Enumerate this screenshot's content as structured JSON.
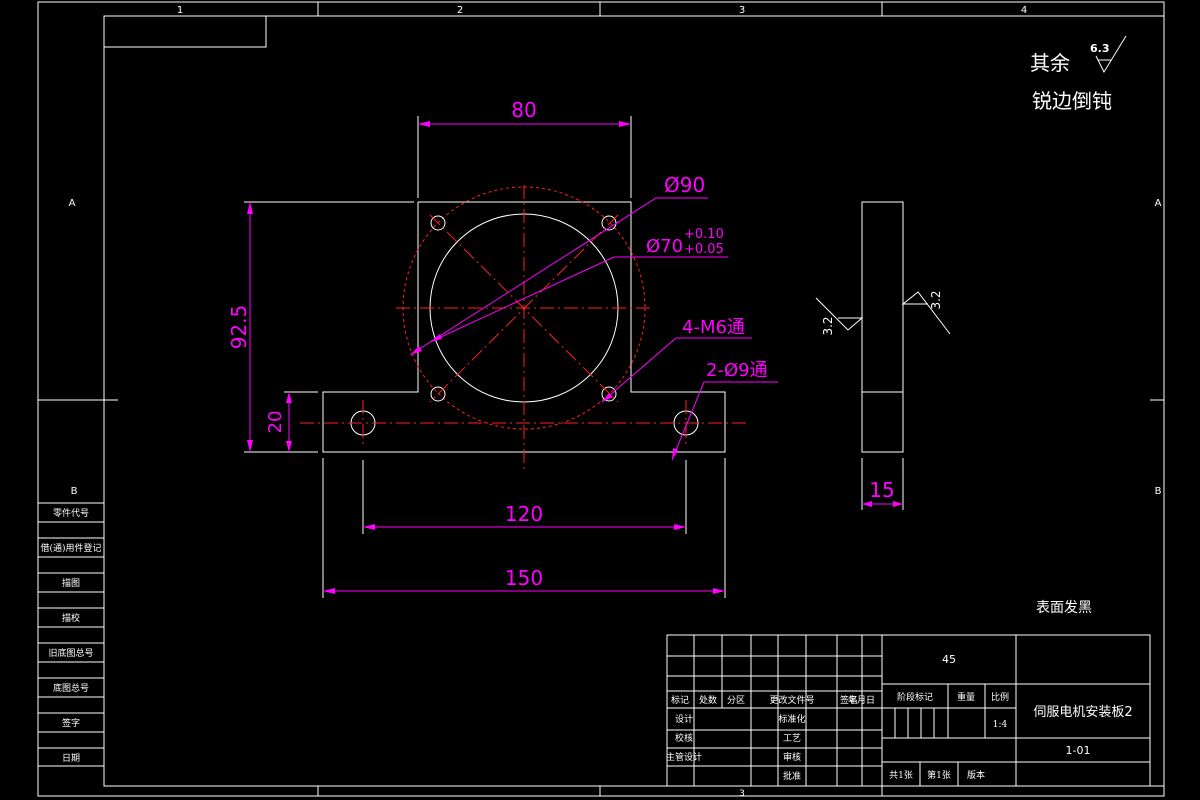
{
  "zone_labels": {
    "col1": "1",
    "col2": "2",
    "col3": "3",
    "col4": "4",
    "row_a": "A",
    "row_b": "B",
    "bottom_col3": "3"
  },
  "notes": {
    "roughness_prefix": "其余",
    "roughness_value": "6.3",
    "edge_note": "锐边倒钝",
    "surface_treatment": "表面发黑"
  },
  "dimensions": {
    "width_top": "80",
    "dia_outer": "Ø90",
    "dia_bore": "Ø70",
    "tol_upper": "+0.10",
    "tol_lower": "+0.05",
    "hole_tapped": "4-M6通",
    "hole_through": "2-Ø9通",
    "height_total": "92.5",
    "height_base": "20",
    "hole_spacing": "120",
    "width_total": "150",
    "thickness": "15",
    "side_rough_left": "3.2",
    "side_rough_right": "3.2"
  },
  "left_strip": [
    "零件代号",
    "借(通)用件登记",
    "描图",
    "描校",
    "旧底图总号",
    "底图总号",
    "签字",
    "日期"
  ],
  "title_block": {
    "material": "45",
    "part_name": "伺服电机安装板2",
    "drawing_no": "1-01",
    "scale_label": "比例",
    "scale": "1:4",
    "stage_label": "阶段标记",
    "weight_label": "重量",
    "header_cells": [
      "标记",
      "处数",
      "分区",
      "更改文件号",
      "签名",
      "年月日"
    ],
    "row_design": "设计",
    "row_check": "校核",
    "row_chief": "主管设计",
    "row_std": "标准化",
    "row_craft": "工艺",
    "row_audit": "审核",
    "row_approve": "批准",
    "sheets_total": "共1张",
    "sheet_no": "第1张",
    "version": "版本"
  }
}
